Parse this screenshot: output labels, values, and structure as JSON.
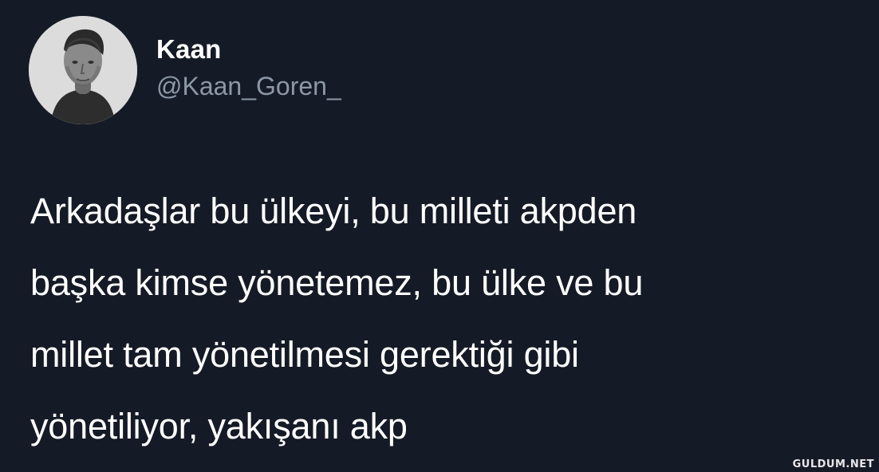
{
  "tweet": {
    "display_name": "Kaan",
    "handle": "@Kaan_Goren_",
    "text_lines": [
      "Arkadaşlar bu ülkeyi, bu milleti akpden",
      "başka kimse yönetemez, bu ülke ve bu",
      "millet tam yönetilmesi gerektiği gibi",
      "yönetiliyor, yakışanı akp"
    ]
  },
  "avatar": {
    "icon": "profile-photo"
  },
  "watermark": {
    "text": "GULDUM.NET"
  },
  "colors": {
    "background": "#151b26",
    "text": "#ffffff",
    "handle": "#8d98a7"
  }
}
